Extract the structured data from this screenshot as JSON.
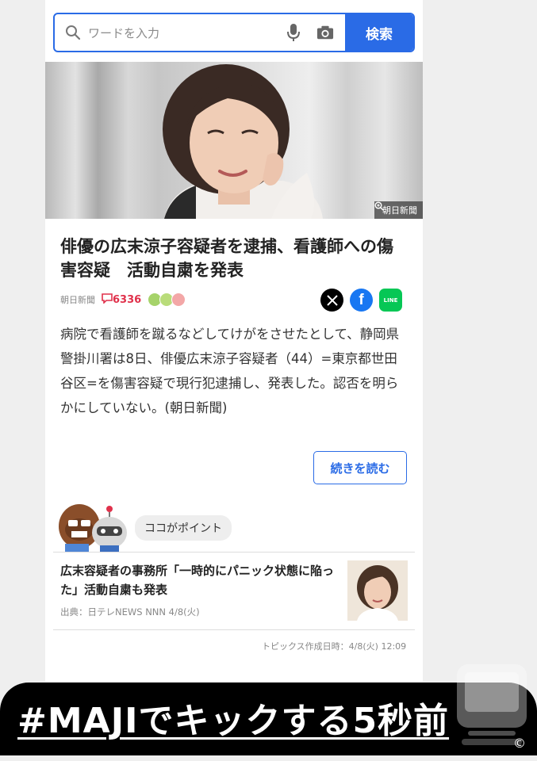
{
  "search": {
    "placeholder": "ワードを入力",
    "button_label": "検索",
    "icons": [
      "search-icon",
      "microphone-icon",
      "camera-icon"
    ]
  },
  "hero": {
    "credit": "朝日新聞"
  },
  "article": {
    "title": "俳優の広末涼子容疑者を逮捕、看護師への傷害容疑　活動自粛を発表",
    "source": "朝日新聞",
    "comment_count": "6336",
    "body": "病院で看護師を蹴るなどしてけがをさせたとして、静岡県警掛川署は8日、俳優広末涼子容疑者（44）=東京都世田谷区=を傷害容疑で現行犯逮捕し、発表した。認否を明らかにしていない。(朝日新聞)",
    "read_more": "続きを読む",
    "share": [
      "x-icon",
      "facebook-icon",
      "line-icon"
    ],
    "line_label": "LINE"
  },
  "point": {
    "label": "ココがポイント"
  },
  "related": {
    "title": "広末容疑者の事務所「一時的にパニック状態に陥った」活動自粛も発表",
    "source": "出典：日テレNEWS NNN 4/8(火)"
  },
  "timestamp": "トピックス作成日時：4/8(火) 12:09",
  "overlay": {
    "hashtag": "#MAJIでキックする5秒前",
    "copyright": "©"
  },
  "colors": {
    "accent": "#2a6be6",
    "comment": "#e0314b",
    "x": "#000000",
    "facebook": "#1877f2",
    "line": "#06c755"
  }
}
